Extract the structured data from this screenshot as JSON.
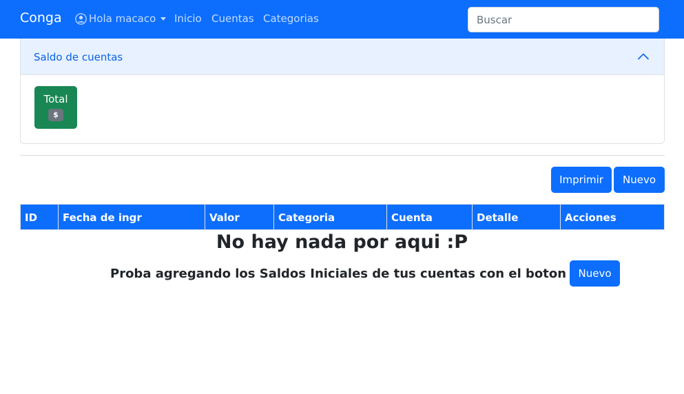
{
  "navbar": {
    "brand": "Conga",
    "user_menu": "Hola macaco",
    "links": [
      "Inicio",
      "Cuentas",
      "Categorias"
    ],
    "search_placeholder": "Buscar"
  },
  "accordion": {
    "title": "Saldo de cuentas",
    "total_label": "Total",
    "total_badge": "$"
  },
  "toolbar": {
    "print_label": "Imprimir",
    "new_label": "Nuevo"
  },
  "table": {
    "columns": [
      "ID",
      "Fecha de ingr",
      "Valor",
      "Categoria",
      "Cuenta",
      "Detalle",
      "Acciones"
    ]
  },
  "empty_state": {
    "title": "No hay nada por aqui :P",
    "message": "Proba agregando los Saldos Iniciales de tus cuentas con el boton",
    "button_label": "Nuevo"
  },
  "colors": {
    "primary": "#0d6efd",
    "success": "#198754",
    "accordion_bg": "#e7f1ff",
    "accordion_text": "#0c63e4"
  }
}
